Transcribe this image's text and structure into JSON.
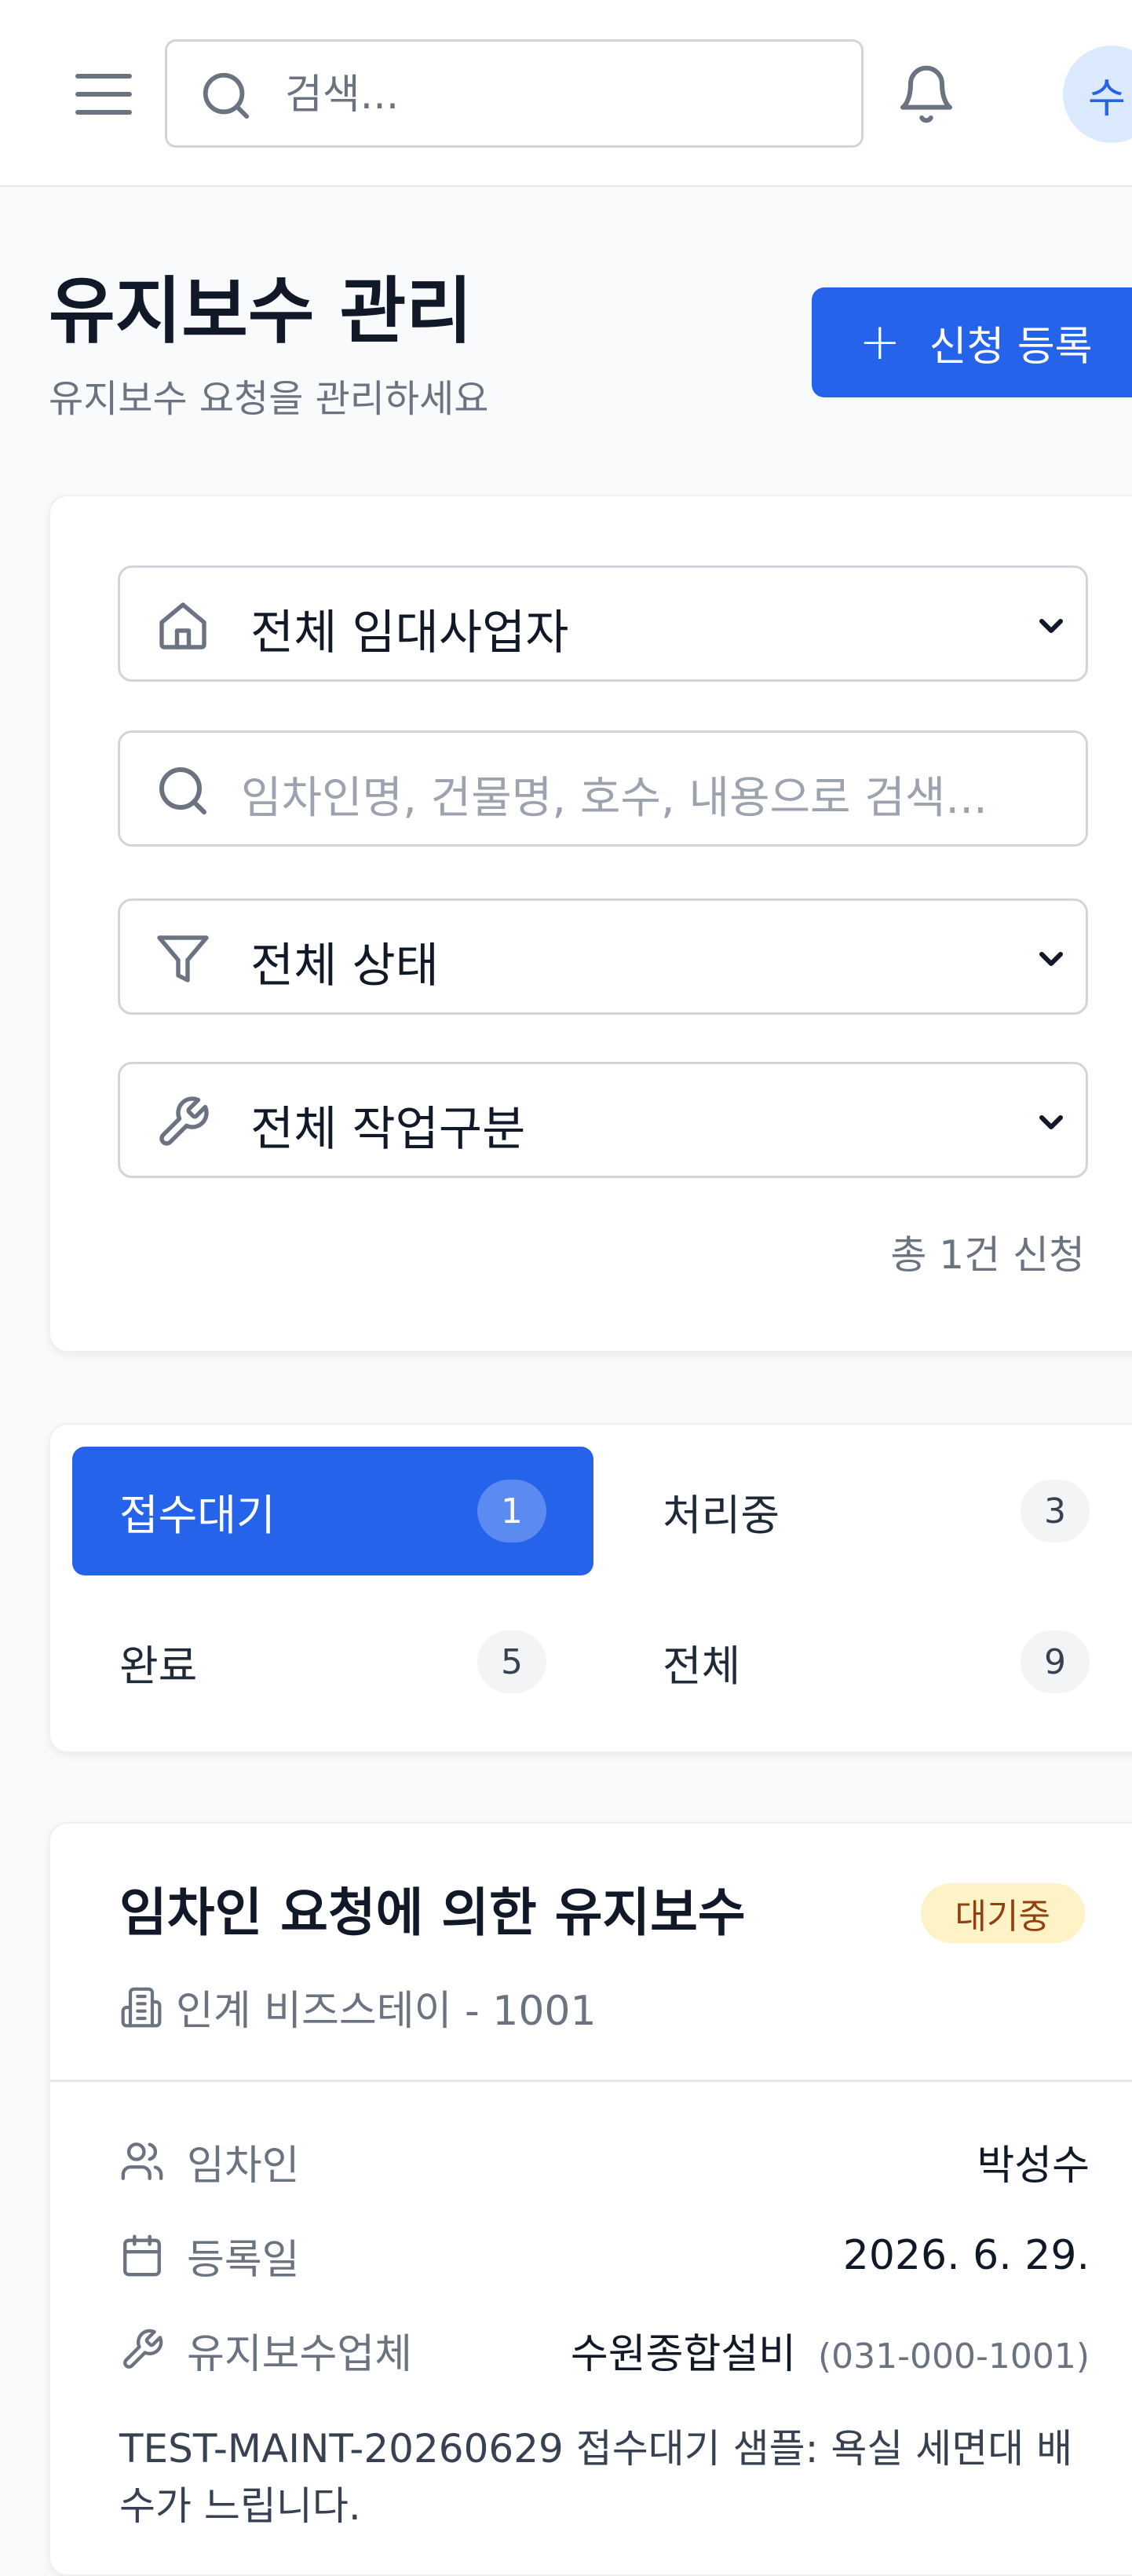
{
  "topbar": {
    "search_placeholder": "검색...",
    "avatar_initial": "수"
  },
  "header": {
    "title": "유지보수 관리",
    "subtitle": "유지보수 요청을 관리하세요",
    "add_button_label": "신청 등록"
  },
  "filters": {
    "lessor_select": "전체 임대사업자",
    "search_placeholder": "임차인명, 건물명, 호수, 내용으로 검색...",
    "status_select": "전체 상태",
    "work_type_select": "전체 작업구분",
    "total_count": "총 1건 신청"
  },
  "tabs": [
    {
      "label": "접수대기",
      "count": "1",
      "active": true
    },
    {
      "label": "처리중",
      "count": "3",
      "active": false
    },
    {
      "label": "완료",
      "count": "5",
      "active": false
    },
    {
      "label": "전체",
      "count": "9",
      "active": false
    }
  ],
  "request": {
    "title": "임차인 요청에 의한 유지보수",
    "status": "대기중",
    "building": "인계 비즈스테이 - 1001",
    "tenant_label": "임차인",
    "tenant_value": "박성수",
    "date_label": "등록일",
    "date_value": "2026. 6. 29.",
    "vendor_label": "유지보수업체",
    "vendor_value": "수원종합설비",
    "vendor_phone": "(031-000-1001)",
    "description": "TEST-MAINT-20260629 접수대기 샘플: 욕실 세면대 배수가 느립니다."
  },
  "colors": {
    "primary": "#2563eb",
    "badge_bg": "#fef3c7",
    "badge_text": "#92400e"
  }
}
